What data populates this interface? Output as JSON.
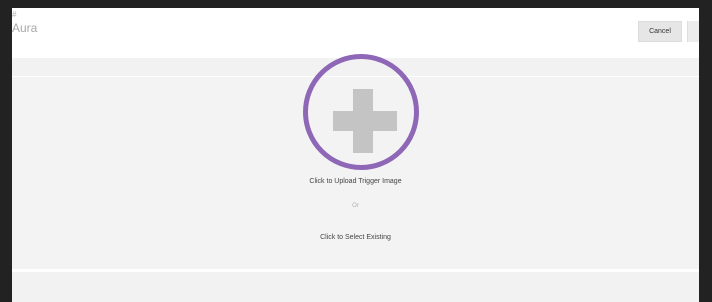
{
  "header": {
    "brand_small": "#",
    "brand": "Aura",
    "cancel_label": "Cancel"
  },
  "upload": {
    "upload_label": "Click to Upload Trigger Image",
    "or_label": "Or",
    "select_label": "Click to Select Existing"
  },
  "icons": {
    "add": "plus-icon"
  },
  "colors": {
    "accent": "#8f67b7",
    "plus": "#c4c4c4",
    "frame": "#222222"
  }
}
